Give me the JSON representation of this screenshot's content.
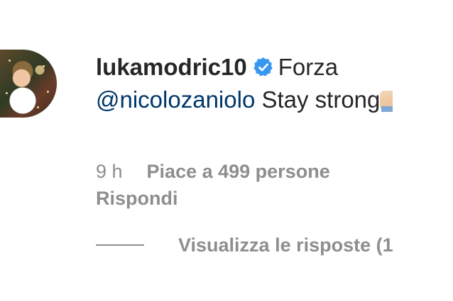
{
  "comment": {
    "username": "lukamodric10",
    "text_before_mention": "Forza",
    "mention": "@nicolozaniolo",
    "text_after_mention": "Stay strong",
    "time": "9 h",
    "likes": "Piace a 499 persone",
    "reply": "Rispondi",
    "view_replies": "Visualizza le risposte (1",
    "icons": {
      "avatar": "profile-photo",
      "verified": "verified-badge-icon",
      "emoji": "flexed-arm-emoji"
    },
    "colors": {
      "text": "#262626",
      "mention": "#00376b",
      "meta": "#8e8e8e",
      "verified": "#3897f0"
    }
  }
}
